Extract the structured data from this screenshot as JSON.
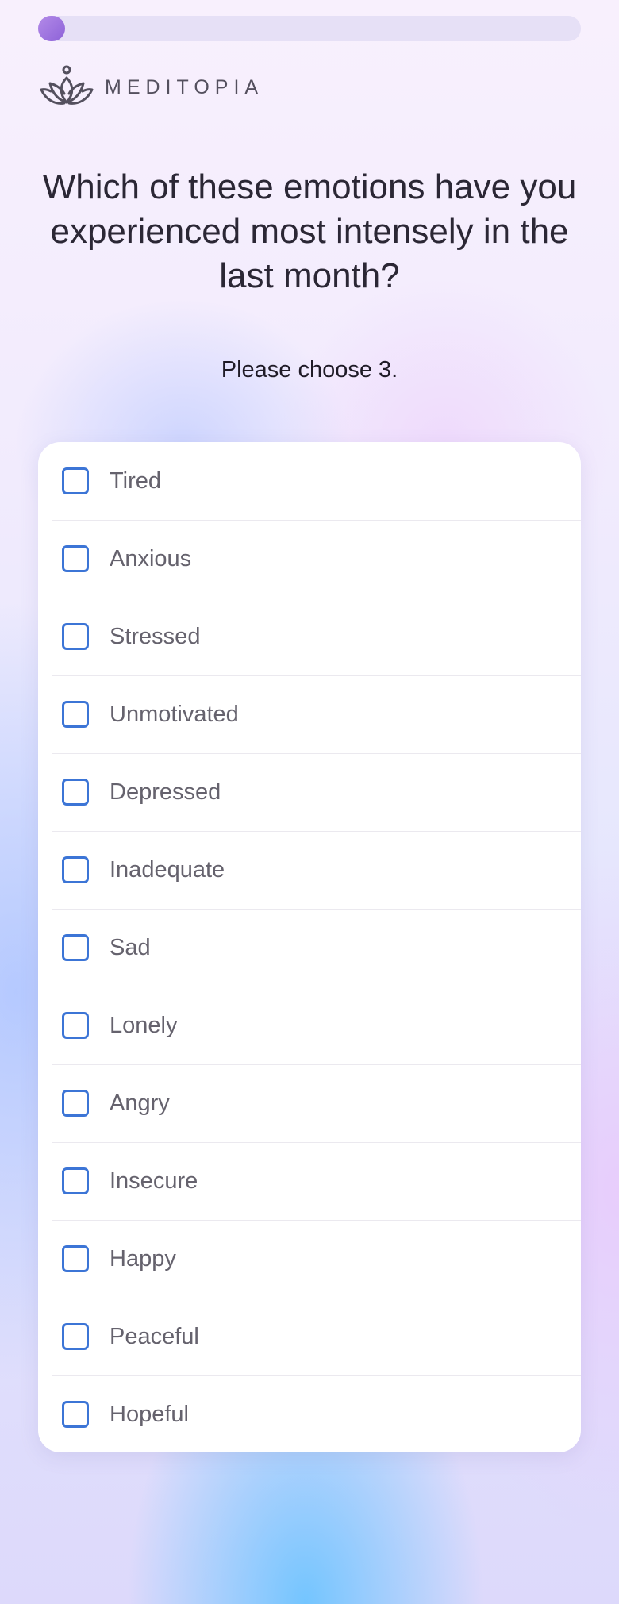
{
  "progress": {
    "value_percent": 5
  },
  "brand": {
    "name": "MEDITOPIA",
    "logo_icon": "lotus-icon"
  },
  "question": {
    "title": "Which of these emotions have you experienced most intensely in the last month?",
    "instruction": "Please choose 3."
  },
  "options": [
    {
      "label": "Tired",
      "checked": false
    },
    {
      "label": "Anxious",
      "checked": false
    },
    {
      "label": "Stressed",
      "checked": false
    },
    {
      "label": "Unmotivated",
      "checked": false
    },
    {
      "label": "Depressed",
      "checked": false
    },
    {
      "label": "Inadequate",
      "checked": false
    },
    {
      "label": "Sad",
      "checked": false
    },
    {
      "label": "Lonely",
      "checked": false
    },
    {
      "label": "Angry",
      "checked": false
    },
    {
      "label": "Insecure",
      "checked": false
    },
    {
      "label": "Happy",
      "checked": false
    },
    {
      "label": "Peaceful",
      "checked": false
    },
    {
      "label": "Hopeful",
      "checked": false
    }
  ],
  "colors": {
    "accent_purple": "#9a6ee0",
    "checkbox_blue": "#3c75d6",
    "text_dark": "#2b2735",
    "option_text": "#65626d"
  }
}
